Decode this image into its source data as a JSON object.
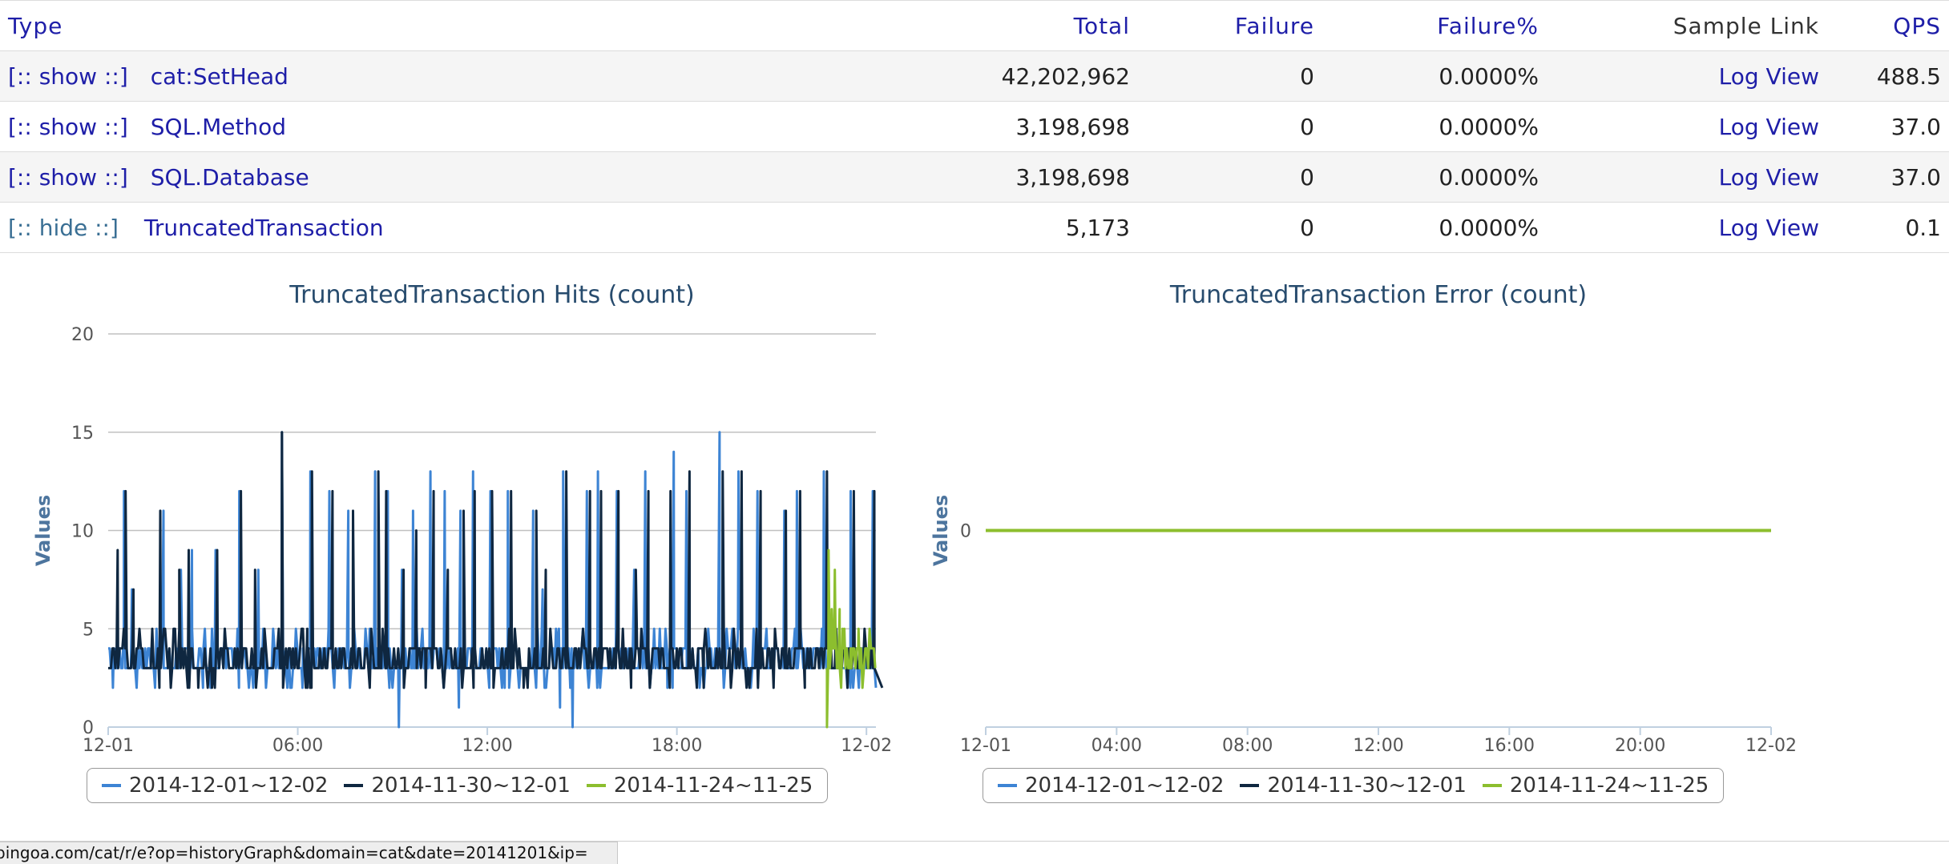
{
  "table": {
    "headers": {
      "type": "Type",
      "total": "Total",
      "failure": "Failure",
      "failure_pct": "Failure%",
      "sample_link": "Sample Link",
      "qps": "QPS"
    },
    "rows": [
      {
        "toggle": "[:: show ::]",
        "name": "cat:SetHead",
        "total": "42,202,962",
        "failure": "0",
        "failure_pct": "0.0000%",
        "link": "Log View",
        "qps": "488.5"
      },
      {
        "toggle": "[:: show ::]",
        "name": "SQL.Method",
        "total": "3,198,698",
        "failure": "0",
        "failure_pct": "0.0000%",
        "link": "Log View",
        "qps": "37.0"
      },
      {
        "toggle": "[:: show ::]",
        "name": "SQL.Database",
        "total": "3,198,698",
        "failure": "0",
        "failure_pct": "0.0000%",
        "link": "Log View",
        "qps": "37.0"
      },
      {
        "toggle": "[:: hide ::]",
        "name": "TruncatedTransaction",
        "total": "5,173",
        "failure": "0",
        "failure_pct": "0.0000%",
        "link": "Log View",
        "qps": "0.1"
      }
    ]
  },
  "chart_data": [
    {
      "type": "line",
      "title": "TruncatedTransaction Hits (count)",
      "ylabel": "Values",
      "xlabel": "",
      "ylim": [
        0,
        20
      ],
      "yticks": [
        "0",
        "5",
        "10",
        "15",
        "20"
      ],
      "xticks": [
        "12-01",
        "06:00",
        "12:00",
        "18:00",
        "12-02"
      ],
      "grid": true,
      "legend_position": "bottom",
      "series": [
        {
          "name": "2014-12-01~12-02",
          "color": "#3d84d4",
          "baseline": 3,
          "spikes": [
            [
              0.5,
              4
            ],
            [
              1,
              12
            ],
            [
              1.5,
              7
            ],
            [
              3.5,
              11
            ],
            [
              4.6,
              8
            ],
            [
              5.3,
              9
            ],
            [
              6.8,
              9
            ],
            [
              8.3,
              12
            ],
            [
              9.5,
              8
            ],
            [
              11,
              15
            ],
            [
              12.8,
              13
            ],
            [
              14,
              12
            ],
            [
              15.2,
              11
            ],
            [
              16.9,
              13
            ],
            [
              17.7,
              12
            ],
            [
              18.6,
              8
            ],
            [
              19.3,
              11
            ],
            [
              20.4,
              13
            ],
            [
              21.3,
              12
            ],
            [
              22.3,
              11
            ],
            [
              23.1,
              13
            ],
            [
              24.2,
              12
            ],
            [
              25.3,
              12
            ],
            [
              26.9,
              11
            ],
            [
              27.5,
              7
            ],
            [
              28.8,
              13
            ],
            [
              30.3,
              12
            ],
            [
              31,
              13
            ],
            [
              32.2,
              12
            ],
            [
              33.3,
              8
            ],
            [
              34,
              13
            ],
            [
              35.8,
              14
            ],
            [
              36.6,
              12
            ],
            [
              38.7,
              15
            ],
            [
              39.9,
              13
            ],
            [
              41.1,
              12
            ],
            [
              42.8,
              11
            ],
            [
              43.6,
              12
            ],
            [
              45.3,
              13
            ],
            [
              47,
              12
            ],
            [
              48.4,
              12
            ]
          ],
          "dips": [
            [
              0.3,
              2
            ],
            [
              6,
              2
            ],
            [
              12.3,
              2
            ],
            [
              17.8,
              2
            ],
            [
              18.4,
              0
            ],
            [
              22.2,
              1
            ],
            [
              25.1,
              2
            ],
            [
              28.6,
              1
            ],
            [
              29.4,
              0
            ],
            [
              35.4,
              2
            ],
            [
              40.6,
              2
            ],
            [
              46.8,
              2
            ],
            [
              48.6,
              2
            ]
          ]
        },
        {
          "name": "2014-11-30~12-01",
          "color": "#0f2740",
          "baseline": 3,
          "spikes": [
            [
              0.6,
              9
            ],
            [
              1.1,
              12
            ],
            [
              1.6,
              7
            ],
            [
              3.3,
              11
            ],
            [
              4.5,
              8
            ],
            [
              5.1,
              9
            ],
            [
              6.9,
              9
            ],
            [
              8.4,
              12
            ],
            [
              9.3,
              8
            ],
            [
              11,
              15
            ],
            [
              12.9,
              13
            ],
            [
              14.2,
              12
            ],
            [
              15.5,
              11
            ],
            [
              17.1,
              13
            ],
            [
              17.6,
              12
            ],
            [
              18.7,
              8
            ],
            [
              19.5,
              10
            ],
            [
              20.6,
              12
            ],
            [
              21.5,
              8
            ],
            [
              22.5,
              11
            ],
            [
              23.2,
              12
            ],
            [
              24.3,
              12
            ],
            [
              25.5,
              12
            ],
            [
              27.1,
              11
            ],
            [
              27.7,
              8
            ],
            [
              29,
              13
            ],
            [
              30.5,
              12
            ],
            [
              31.2,
              12
            ],
            [
              32.3,
              12
            ],
            [
              33.4,
              8
            ],
            [
              34.2,
              12
            ],
            [
              35.6,
              12
            ],
            [
              36.8,
              13
            ],
            [
              38.9,
              13
            ],
            [
              40.1,
              13
            ],
            [
              41.3,
              12
            ],
            [
              42.9,
              11
            ],
            [
              43.8,
              12
            ],
            [
              45.5,
              13
            ],
            [
              47.2,
              12
            ],
            [
              48.5,
              12
            ]
          ],
          "dips": [
            [
              5.7,
              2
            ],
            [
              12.6,
              2
            ],
            [
              20.1,
              2
            ],
            [
              26.3,
              2
            ],
            [
              33.1,
              2
            ],
            [
              37.7,
              2
            ],
            [
              44.1,
              2
            ],
            [
              49,
              2
            ]
          ]
        },
        {
          "name": "2014-11-24~11-25",
          "color": "#8cbe2e",
          "baseline": 3,
          "start_hour": 45.5,
          "spikes": [
            [
              45.6,
              9
            ],
            [
              45.8,
              6
            ],
            [
              46,
              8
            ],
            [
              46.3,
              6
            ],
            [
              46.6,
              5
            ],
            [
              47,
              4
            ],
            [
              47.5,
              5
            ],
            [
              48,
              4
            ],
            [
              48.4,
              4
            ]
          ],
          "dips": [
            [
              45.5,
              0
            ]
          ]
        }
      ]
    },
    {
      "type": "line",
      "title": "TruncatedTransaction Error (count)",
      "ylabel": "Values",
      "xlabel": "",
      "yticks": [
        "0"
      ],
      "xticks": [
        "12-01",
        "04:00",
        "08:00",
        "12:00",
        "16:00",
        "20:00",
        "12-02"
      ],
      "grid": false,
      "legend_position": "bottom",
      "series": [
        {
          "name": "2014-12-01~12-02",
          "color": "#3d84d4",
          "constant": 0
        },
        {
          "name": "2014-11-30~12-01",
          "color": "#0f2740",
          "constant": 0
        },
        {
          "name": "2014-11-24~11-25",
          "color": "#8cbe2e",
          "constant": 0
        }
      ]
    }
  ],
  "status_bar": {
    "url": "pingoa.com/cat/r/e?op=historyGraph&domain=cat&date=20141201&ip="
  }
}
